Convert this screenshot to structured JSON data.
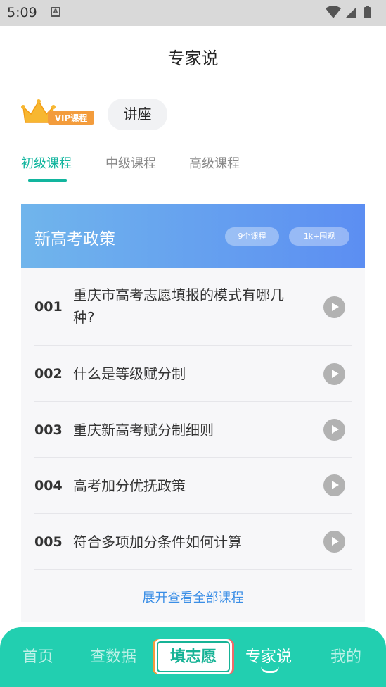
{
  "status_bar": {
    "time": "5:09",
    "notification_icon": "A"
  },
  "header": {
    "title": "专家说"
  },
  "category": {
    "vip_label": "VIP课程",
    "lecture_label": "讲座"
  },
  "tabs": [
    {
      "label": "初级课程",
      "active": true
    },
    {
      "label": "中级课程",
      "active": false
    },
    {
      "label": "高级课程",
      "active": false
    }
  ],
  "course_card": {
    "title": "新高考政策",
    "lesson_count": "9个课程",
    "views": "1k+围观",
    "lessons": [
      {
        "num": "001",
        "title": "重庆市高考志愿填报的模式有哪几种?"
      },
      {
        "num": "002",
        "title": "什么是等级赋分制"
      },
      {
        "num": "003",
        "title": "重庆新高考赋分制细则"
      },
      {
        "num": "004",
        "title": "高考加分优抚政策"
      },
      {
        "num": "005",
        "title": "符合多项加分条件如何计算"
      }
    ],
    "expand_label": "展开查看全部课程"
  },
  "bottom_nav": {
    "items": [
      {
        "label": "首页",
        "active": false
      },
      {
        "label": "查数据",
        "active": false
      },
      {
        "label": "专家说",
        "active": true
      },
      {
        "label": "我的",
        "active": false
      }
    ],
    "center_logo": "填志愿"
  },
  "colors": {
    "accent": "#12b59e",
    "nav_bg": "#22cfb0",
    "link": "#3a8ee6",
    "header_gradient_start": "#70b5ec",
    "header_gradient_end": "#5c8ef2"
  }
}
